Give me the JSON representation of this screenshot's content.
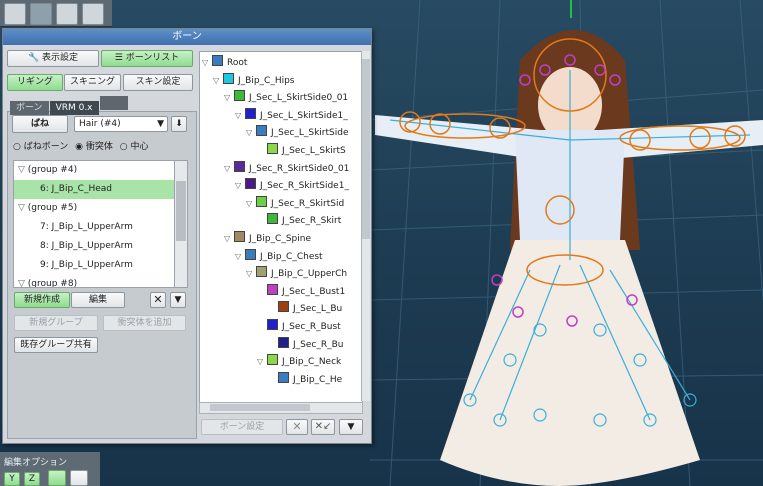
{
  "colors": {
    "accent_green": "#8fdc8f",
    "title_blue": "#4f80bf",
    "collider_orange": "#e07a1a",
    "bone_cyan": "#3aaed8",
    "spring_magenta": "#c040c0"
  },
  "panel": {
    "title": "ボーン",
    "tabs": {
      "display_settings": "表示設定",
      "bone_list": "ボーンリスト"
    },
    "subtabs": {
      "rigging": "リギング",
      "skinning": "スキニング",
      "skin_settings": "スキン設定"
    },
    "inner_tabs": [
      "ボーン",
      "VRM 0.x",
      ""
    ],
    "spring_button": "ばね",
    "spring_select": "Hair (#4)",
    "radio": [
      "ばねボーン",
      "衝突体",
      "中心"
    ],
    "radio_selected": 1,
    "list": [
      {
        "label": "(group #4)",
        "group": true,
        "selected": false
      },
      {
        "label": "6: J_Bip_C_Head",
        "group": false,
        "selected": true
      },
      {
        "label": "(group #5)",
        "group": true,
        "selected": false
      },
      {
        "label": "7: J_Bip_L_UpperArm",
        "group": false,
        "selected": false
      },
      {
        "label": "8: J_Bip_L_UpperArm",
        "group": false,
        "selected": false
      },
      {
        "label": "9: J_Bip_L_UpperArm",
        "group": false,
        "selected": false
      },
      {
        "label": "(group #8)",
        "group": true,
        "selected": false
      }
    ],
    "new_button": "新規作成",
    "edit_button": "編集",
    "new_group_button": "新規グループ",
    "add_collider_button": "衝突体を追加",
    "share_button": "既存グループ共有",
    "bone_settings_button": "ボーン設定"
  },
  "tree": [
    {
      "label": "Root",
      "color": "#3a7dbf",
      "depth": 0
    },
    {
      "label": "J_Bip_C_Hips",
      "color": "#1ec8e0",
      "depth": 1
    },
    {
      "label": "J_Sec_L_SkirtSide0_01",
      "color": "#3cb83c",
      "depth": 2
    },
    {
      "label": "J_Sec_L_SkirtSide1_",
      "color": "#2020d0",
      "depth": 3
    },
    {
      "label": "J_Sec_L_SkirtSide",
      "color": "#3a7dbf",
      "depth": 4
    },
    {
      "label": "J_Sec_L_SkirtS",
      "color": "#8ad84a",
      "depth": 5
    },
    {
      "label": "J_Sec_R_SkirtSide0_01",
      "color": "#5a2a9a",
      "depth": 2
    },
    {
      "label": "J_Sec_R_SkirtSide1_",
      "color": "#4a1a8a",
      "depth": 3
    },
    {
      "label": "J_Sec_R_SkirtSid",
      "color": "#6ad04a",
      "depth": 4
    },
    {
      "label": "J_Sec_R_Skirt",
      "color": "#3cb83c",
      "depth": 5
    },
    {
      "label": "J_Bip_C_Spine",
      "color": "#a08860",
      "depth": 2
    },
    {
      "label": "J_Bip_C_Chest",
      "color": "#3a7dbf",
      "depth": 3
    },
    {
      "label": "J_Bip_C_UpperCh",
      "color": "#a0a070",
      "depth": 4
    },
    {
      "label": "J_Sec_L_Bust1",
      "color": "#c040c0",
      "depth": 5
    },
    {
      "label": "J_Sec_L_Bu",
      "color": "#a04010",
      "depth": 6
    },
    {
      "label": "J_Sec_R_Bust",
      "color": "#2020d0",
      "depth": 5
    },
    {
      "label": "J_Sec_R_Bu",
      "color": "#20208a",
      "depth": 6
    },
    {
      "label": "J_Bip_C_Neck",
      "color": "#8ad84a",
      "depth": 5
    },
    {
      "label": "J_Bip_C_He",
      "color": "#3a7dbf",
      "depth": 6
    }
  ],
  "bottom_label": "編集オプション",
  "bottom_buttons": [
    "Y",
    "Z"
  ]
}
